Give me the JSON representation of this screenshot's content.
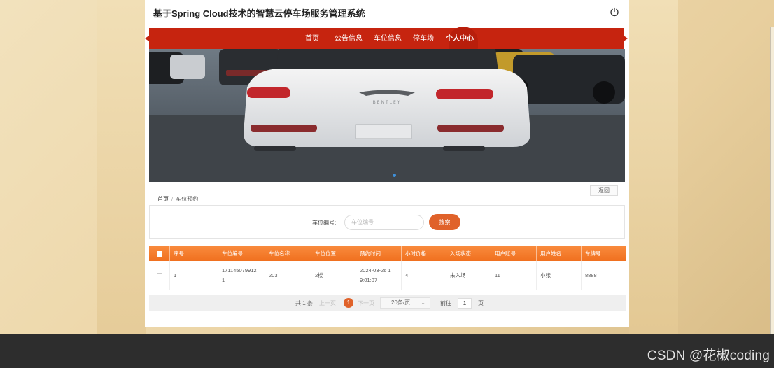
{
  "app": {
    "title": "基于Spring Cloud技术的智慧云停车场服务管理系统"
  },
  "nav": {
    "items": [
      {
        "label": "首页"
      },
      {
        "label": "公告信息"
      },
      {
        "label": "车位信息"
      },
      {
        "label": "停车场"
      },
      {
        "label": "个人中心"
      }
    ],
    "active": "个人中心"
  },
  "banner": {
    "plate_text": "BENTLEY"
  },
  "page": {
    "back_label": "返回",
    "breadcrumb": {
      "home": "首页",
      "separator": "/",
      "current": "车位预约"
    }
  },
  "search": {
    "label": "车位编号:",
    "placeholder": "车位编号",
    "button": "搜索"
  },
  "table": {
    "columns": [
      "序号",
      "车位编号",
      "车位名称",
      "车位位置",
      "预约时间",
      "小时价格",
      "入场状态",
      "用户账号",
      "用户姓名",
      "车牌号"
    ],
    "rows": [
      {
        "index": "1",
        "space_no_l1": "171145079912",
        "space_no_l2": "1",
        "space_name": "203",
        "location": "2楼",
        "time_l1": "2024-03-26 1",
        "time_l2": "9:01:07",
        "price": "4",
        "status": "未入场",
        "account": "11",
        "user_name": "小张",
        "plate": "8888"
      }
    ]
  },
  "pagination": {
    "total": "共 1 条",
    "prev": "上一页",
    "current": "1",
    "next": "下一页",
    "page_size": "20条/页",
    "goto_label": "前往",
    "goto_value": "1",
    "page_unit": "页"
  },
  "watermark": "CSDN @花椒coding",
  "colors": {
    "nav": "#c6240f",
    "accent": "#e0622a",
    "table_header": "#f98a3c"
  }
}
